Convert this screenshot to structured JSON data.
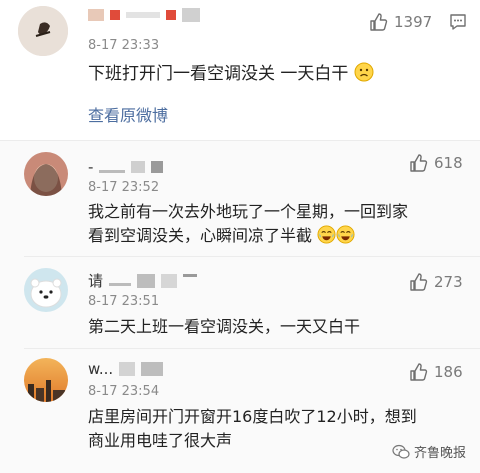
{
  "top_comment": {
    "time": "8-17 23:33",
    "text": "下班打开门一看空调没关  一天白干",
    "likes": "1397",
    "view_link": "查看原微博"
  },
  "replies": [
    {
      "name": "-",
      "time": "8-17 23:52",
      "text_line1": "我之前有一次去外地玩了一个星期，一回到家",
      "text_line2": "看到空调没关，心瞬间凉了半截",
      "likes": "618"
    },
    {
      "name": "请",
      "time": "8-17 23:51",
      "text_line1": "第二天上班一看空调没关，一天又白干",
      "likes": "273"
    },
    {
      "name": "w...",
      "time": "8-17 23:54",
      "text_line1": "店里房间开门开窗开16度白吹了12小时，想到",
      "text_line2": "商业用电哇了很大声",
      "likes": "186"
    }
  ],
  "watermark": "齐鲁晚报",
  "icons": {
    "like": "thumbs-up-icon",
    "message": "chat-bubble-icon",
    "emoji_sad": "worried-face-icon",
    "emoji_cry": "laugh-cry-icon",
    "wechat": "wechat-icon"
  },
  "colors": {
    "link": "#4d6ea0",
    "meta": "#8a8a8a",
    "reply_bg": "#fafafa"
  }
}
